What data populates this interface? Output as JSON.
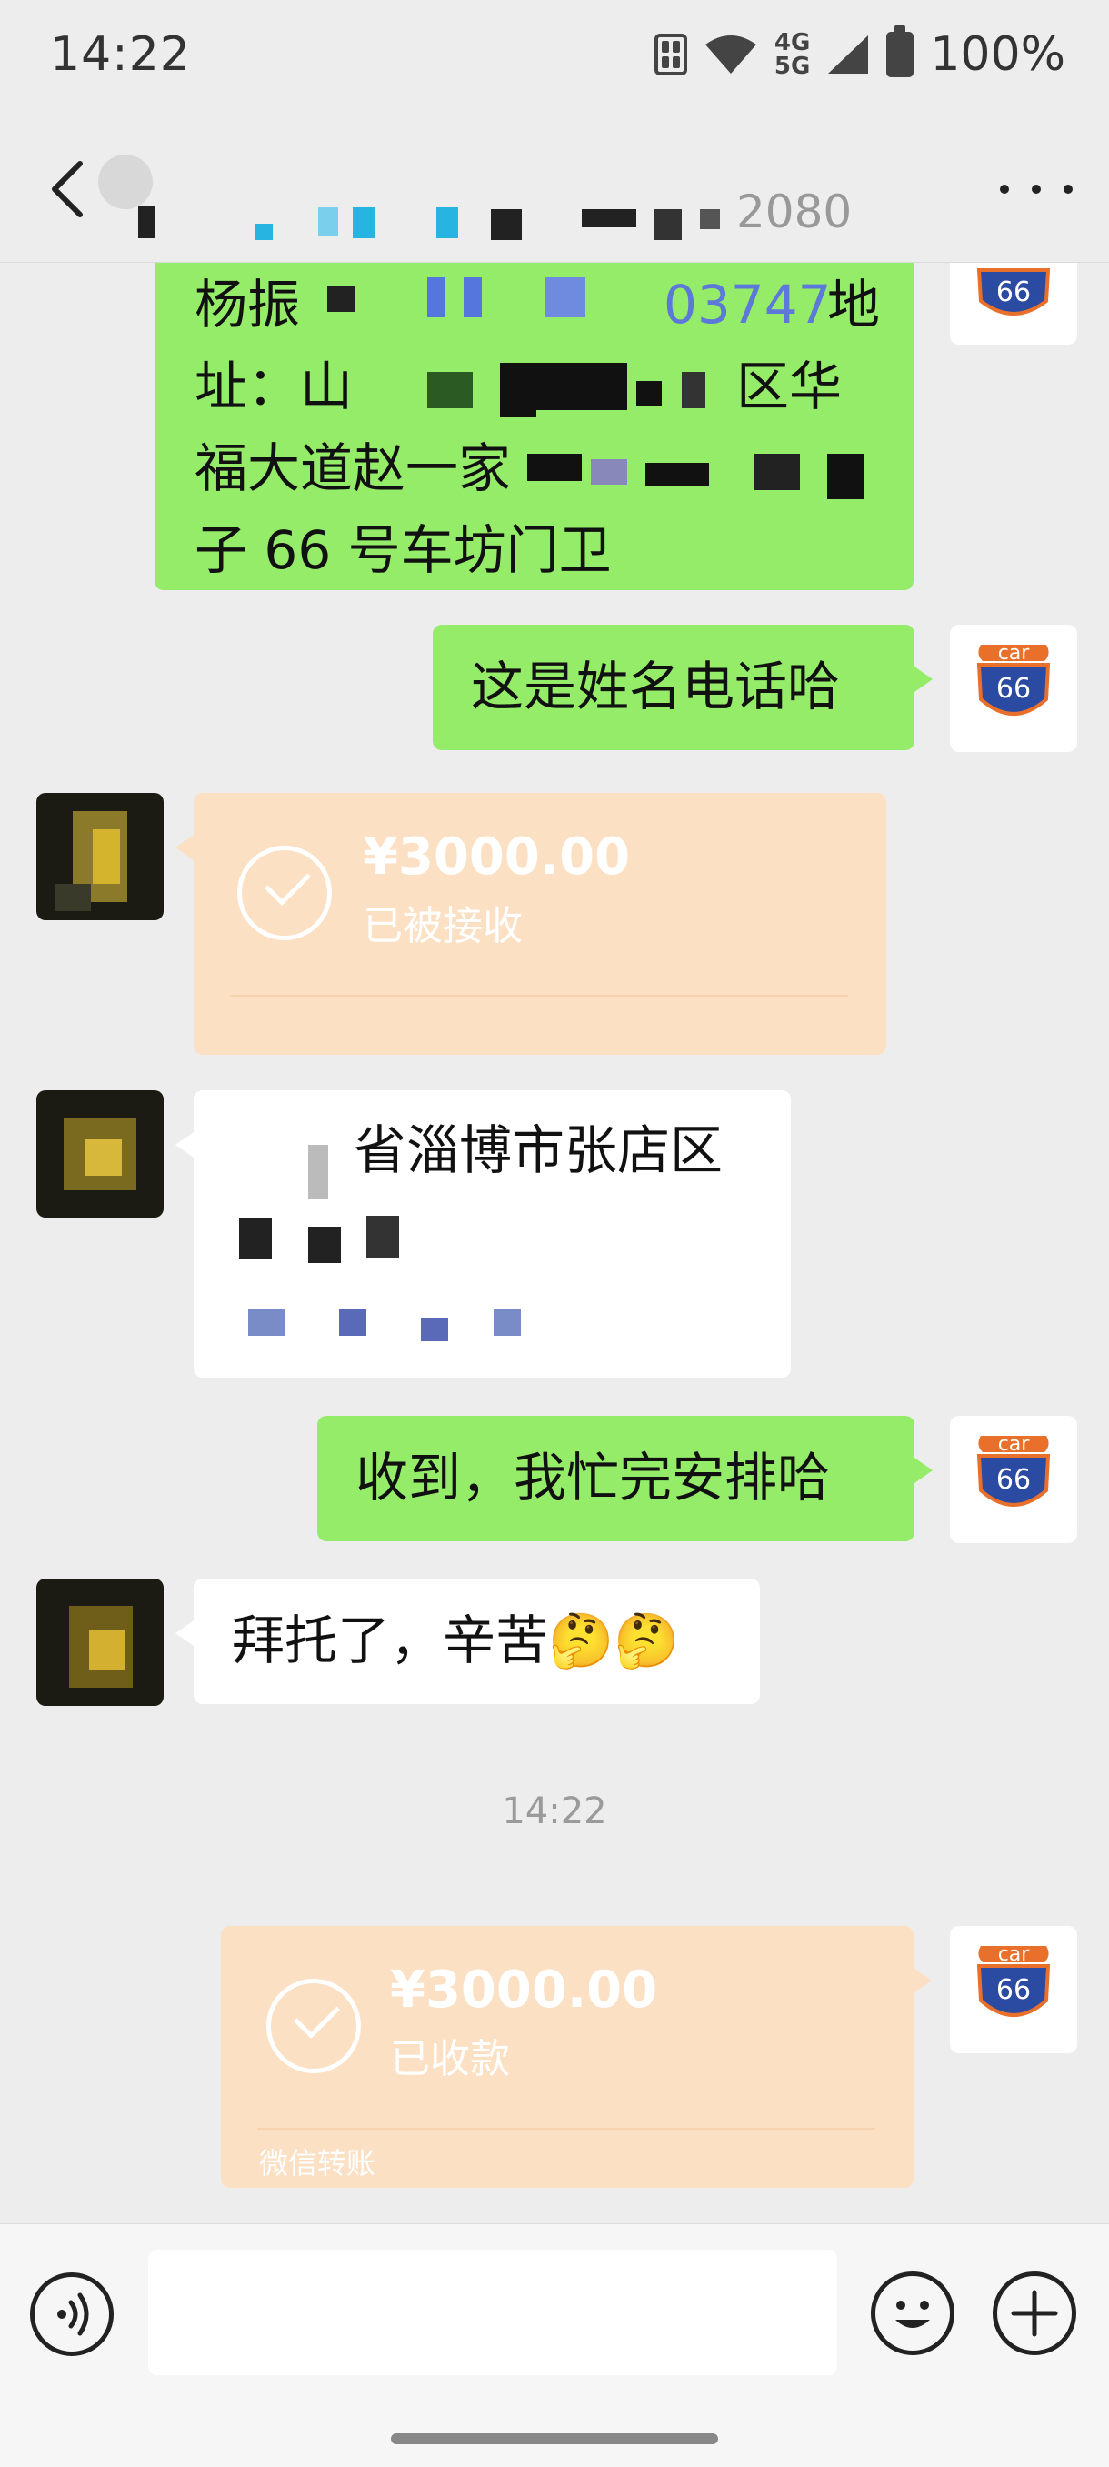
{
  "status_bar": {
    "time": "14:22",
    "network_top": "4G",
    "network_bottom": "5G",
    "battery": "100%",
    "icons": [
      "sim-icon",
      "wifi-icon",
      "signal-icon",
      "battery-icon"
    ]
  },
  "nav": {
    "title_visible_fragment": "2080",
    "back_icon": "chevron-left-icon",
    "more_icon": "more-dots-icon"
  },
  "messages": {
    "address": {
      "line1_a": "杨振",
      "line1_b": "03747",
      "line1_c": "地",
      "line2_a": "址：山",
      "line2_b": "区华",
      "line3": "福大道赵一家",
      "line4": "子 66 号车坊门卫"
    },
    "name_phone": "这是姓名电话哈",
    "transfer_received": {
      "amount": "¥3000.00",
      "status": "已被接收"
    },
    "location": {
      "line1": "省淄博市张店区"
    },
    "reply_received": "收到，我忙完安排哈",
    "thanks": "拜托了，辛苦🤔🤔",
    "timestamp": "14:22",
    "transfer_sent": {
      "amount": "¥3000.00",
      "status": "已收款",
      "footer": "微信转账"
    }
  },
  "self_avatar": {
    "text_top": "car",
    "text_bottom": "66"
  },
  "colors": {
    "background": "#ededed",
    "self_bubble": "#95ec69",
    "other_bubble": "#ffffff",
    "transfer_card": "#fbe0c4",
    "shield_blue": "#2b4aa2",
    "shield_orange": "#e8702a"
  },
  "input_bar": {
    "placeholder": "",
    "icons": [
      "voice-icon",
      "emoji-icon",
      "plus-icon"
    ]
  }
}
